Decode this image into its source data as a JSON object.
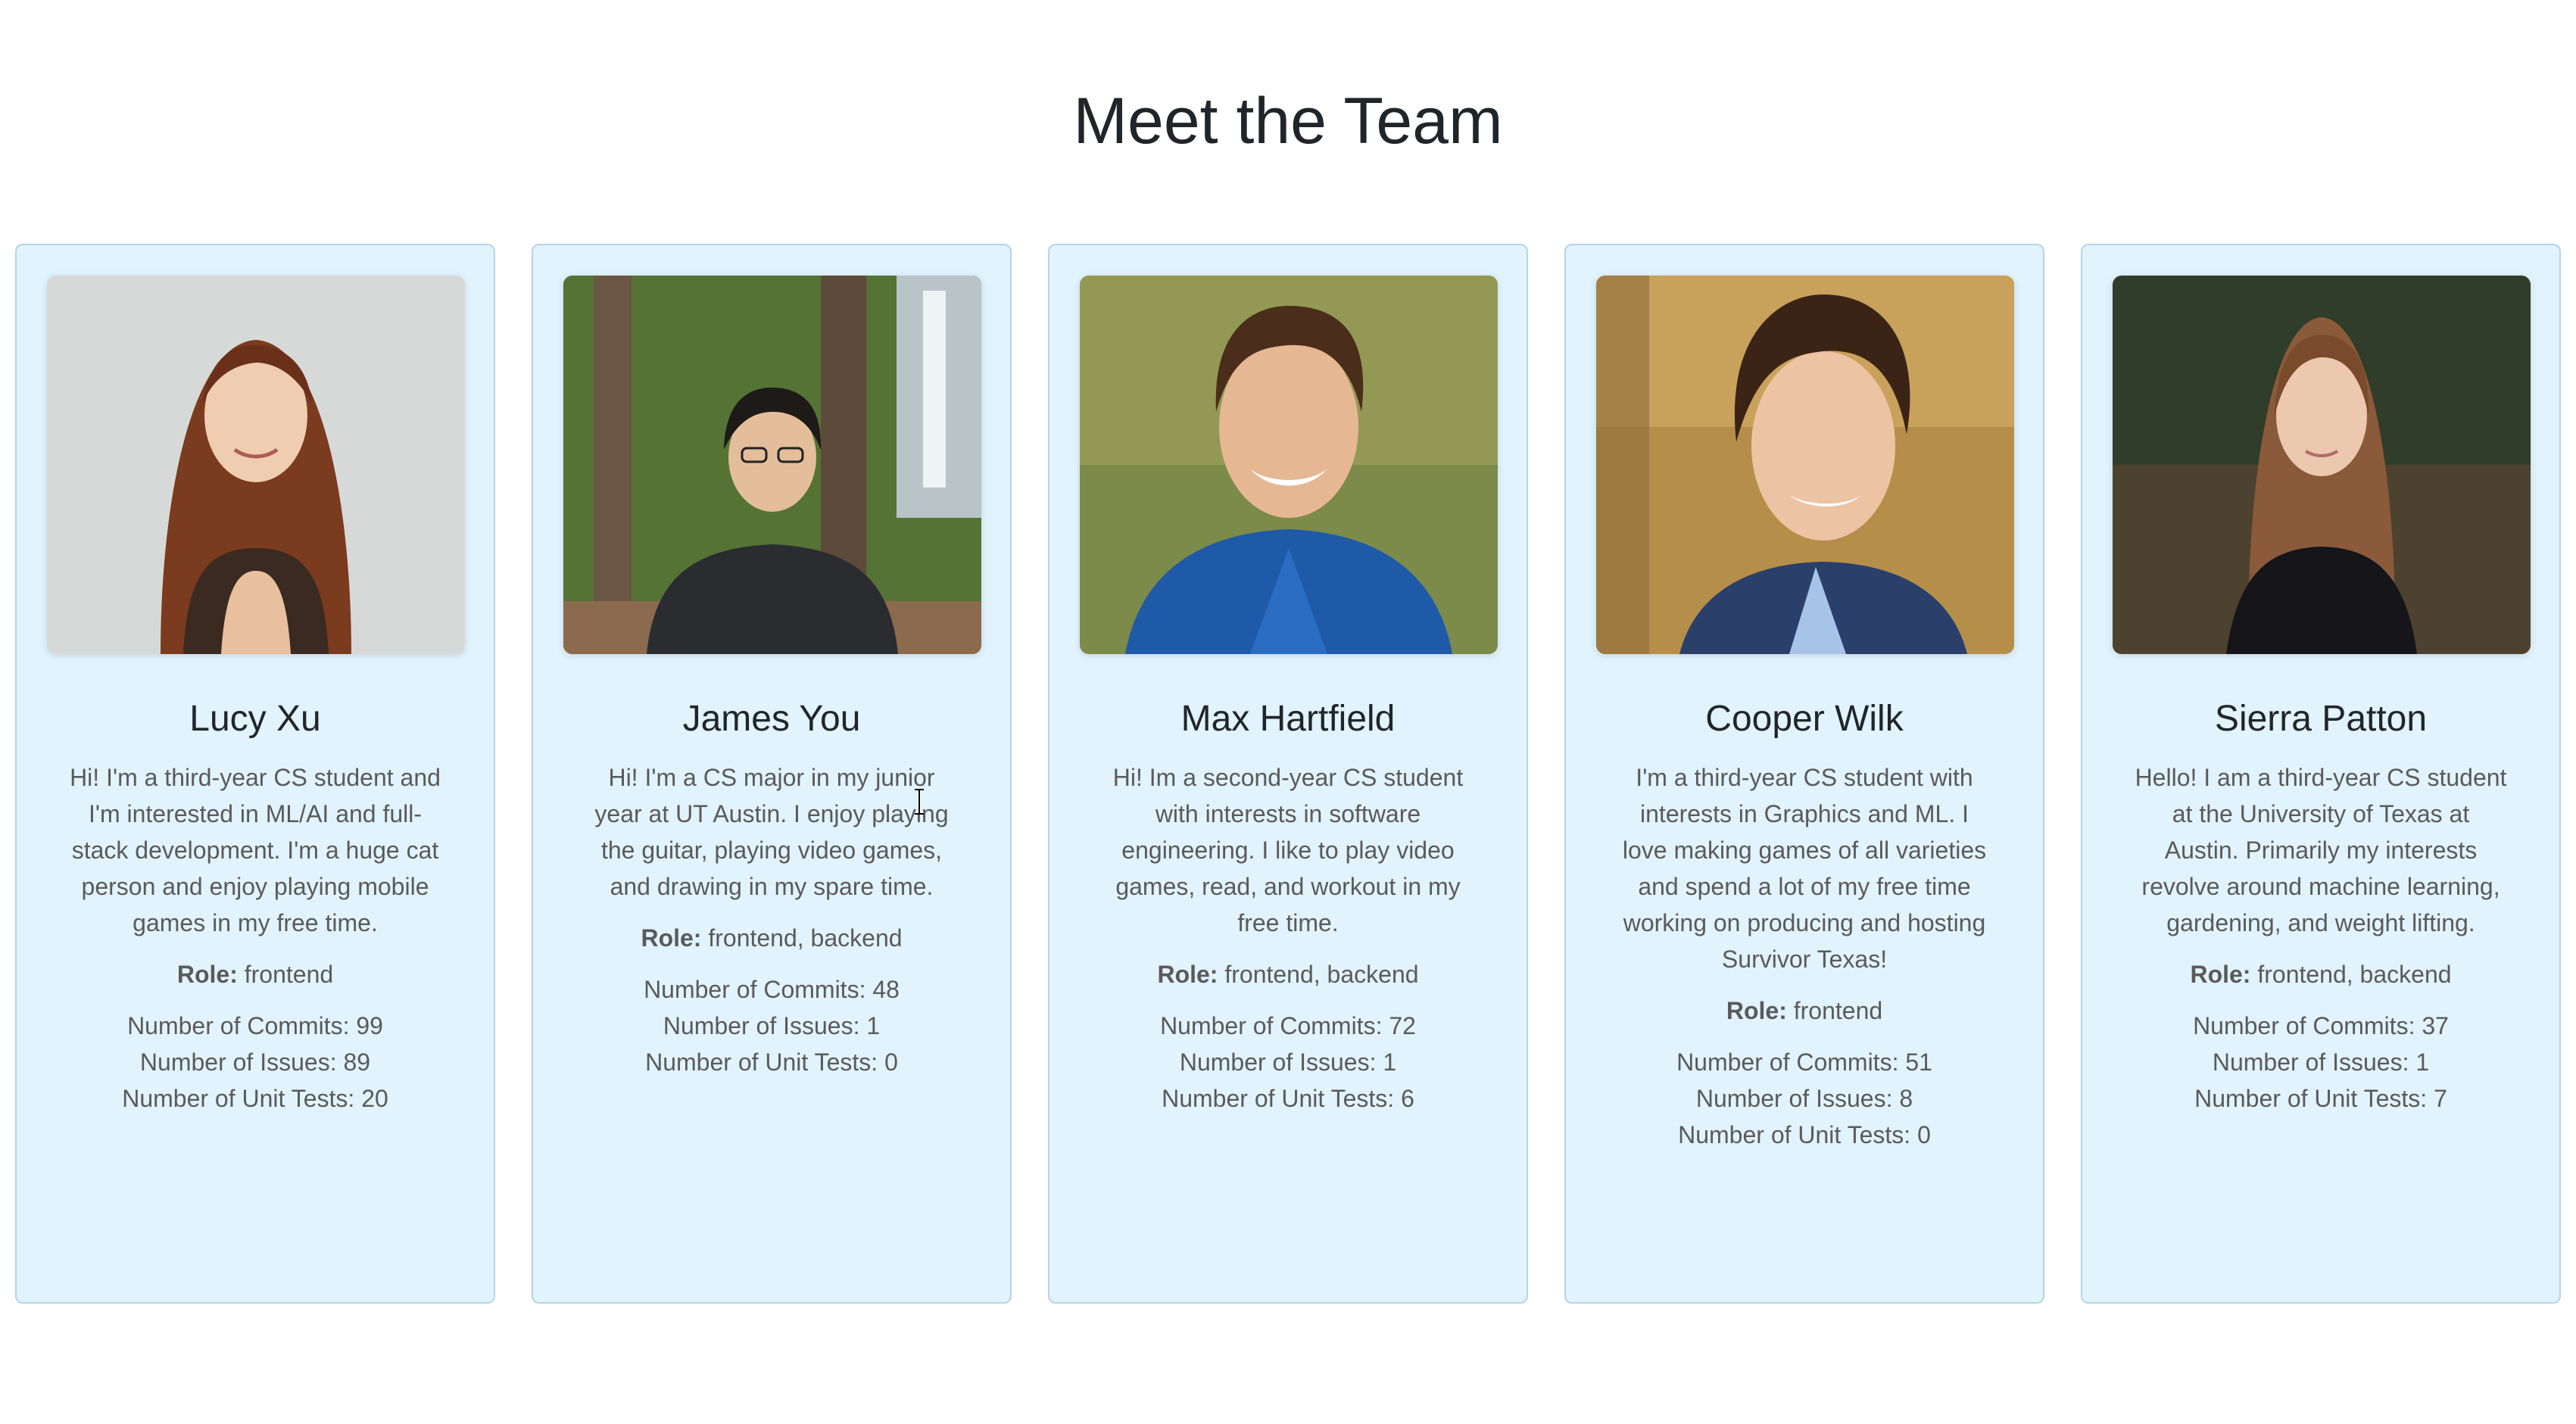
{
  "page": {
    "title": "Meet the Team"
  },
  "members": [
    {
      "name": "Lucy Xu",
      "bio": "Hi! I'm a third-year CS student and I'm interested in ML/AI and full-stack development. I'm a huge cat person and enjoy playing mobile games in my free time.",
      "role_label": "Role:",
      "role": "frontend",
      "commits": "Number of Commits: 99",
      "issues": "Number of Issues: 89",
      "tests": "Number of Unit Tests: 20",
      "photo_icon": "portrait-photo"
    },
    {
      "name": "James You",
      "bio": "Hi! I'm a CS major in my junior year at UT Austin. I enjoy playing the guitar, playing video games, and drawing in my spare time.",
      "role_label": "Role:",
      "role": "frontend, backend",
      "commits": "Number of Commits: 48",
      "issues": "Number of Issues: 1",
      "tests": "Number of Unit Tests: 0",
      "photo_icon": "portrait-photo"
    },
    {
      "name": "Max Hartfield",
      "bio": "Hi! Im a second-year CS student with interests in software engineering. I like to play video games, read, and workout in my free time.",
      "role_label": "Role:",
      "role": "frontend, backend",
      "commits": "Number of Commits: 72",
      "issues": "Number of Issues: 1",
      "tests": "Number of Unit Tests: 6",
      "photo_icon": "portrait-photo"
    },
    {
      "name": "Cooper Wilk",
      "bio": "I'm a third-year CS student with interests in Graphics and ML. I love making games of all varieties and spend a lot of my free time working on producing and hosting Survivor Texas!",
      "role_label": "Role:",
      "role": "frontend",
      "commits": "Number of Commits: 51",
      "issues": "Number of Issues: 8",
      "tests": "Number of Unit Tests: 0",
      "photo_icon": "portrait-photo"
    },
    {
      "name": "Sierra Patton",
      "bio": "Hello! I am a third-year CS student at the University of Texas at Austin. Primarily my interests revolve around machine learning, gardening, and weight lifting.",
      "role_label": "Role:",
      "role": "frontend, backend",
      "commits": "Number of Commits: 37",
      "issues": "Number of Issues: 1",
      "tests": "Number of Unit Tests: 7",
      "photo_icon": "portrait-photo"
    }
  ],
  "colors": {
    "card_background": "#e1f3fd",
    "card_border": "#b7d3e6",
    "title_text": "#212529",
    "body_text": "#5a5a5a"
  }
}
